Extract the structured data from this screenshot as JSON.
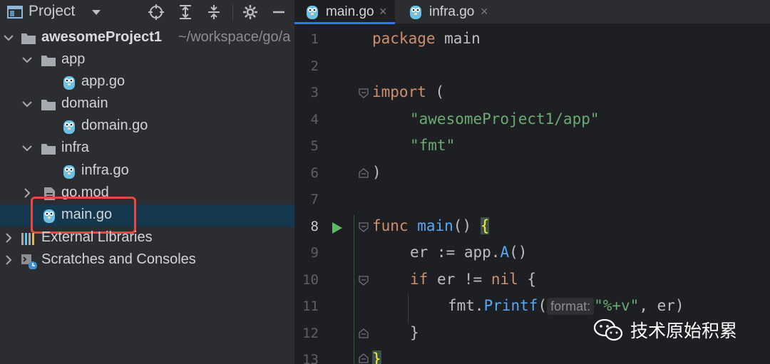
{
  "panel": {
    "title": "Project",
    "dropdown_icon": "chevron-down-icon",
    "toolbar_icons": [
      "locate-icon",
      "expand-all-icon",
      "collapse-all-icon",
      "gear-icon",
      "minimize-icon"
    ]
  },
  "tree": {
    "root": {
      "label": "awesomeProject1",
      "path": "~/workspace/go/a"
    },
    "app_folder": "app",
    "app_file": "app.go",
    "domain_folder": "domain",
    "domain_file": "domain.go",
    "infra_folder": "infra",
    "infra_file": "infra.go",
    "gomod": "go.mod",
    "main_file": "main.go",
    "external": "External Libraries",
    "scratches": "Scratches and Consoles"
  },
  "tabs": [
    {
      "label": "main.go",
      "active": true
    },
    {
      "label": "infra.go",
      "active": false
    }
  ],
  "tab_close": "×",
  "line_numbers": [
    "1",
    "2",
    "3",
    "4",
    "5",
    "6",
    "7",
    "8",
    "9",
    "10",
    "11",
    "12",
    "13"
  ],
  "code": {
    "l1_kw": "package",
    "l1_rest": " main",
    "l3_kw": "import",
    "l3_rest": " (",
    "l4_str": "\"awesomeProject1/app\"",
    "l5_str": "\"fmt\"",
    "l6": ")",
    "l8_kw": "func",
    "l8_fn": " main",
    "l8_paren": "() ",
    "l8_brace": "{",
    "l9_var": "er := app.",
    "l9_fn": "A",
    "l9_rest": "()",
    "l10_kw": "if",
    "l10_mid": " er != ",
    "l10_nil": "nil",
    "l10_rest": " {",
    "l11_pkg": "fmt.",
    "l11_fn": "Printf",
    "l11_paren": "(",
    "l11_hint": "format:",
    "l11_str": "\"%+v\"",
    "l11_rest": ", er)",
    "l12": "}",
    "l13": "}"
  },
  "colors": {
    "keyword": "#cf8e6d",
    "string": "#6aab73",
    "function": "#56a8f5",
    "selection": "#16384f",
    "highlight_box": "#e8483f"
  },
  "watermark": "技术原始积累"
}
